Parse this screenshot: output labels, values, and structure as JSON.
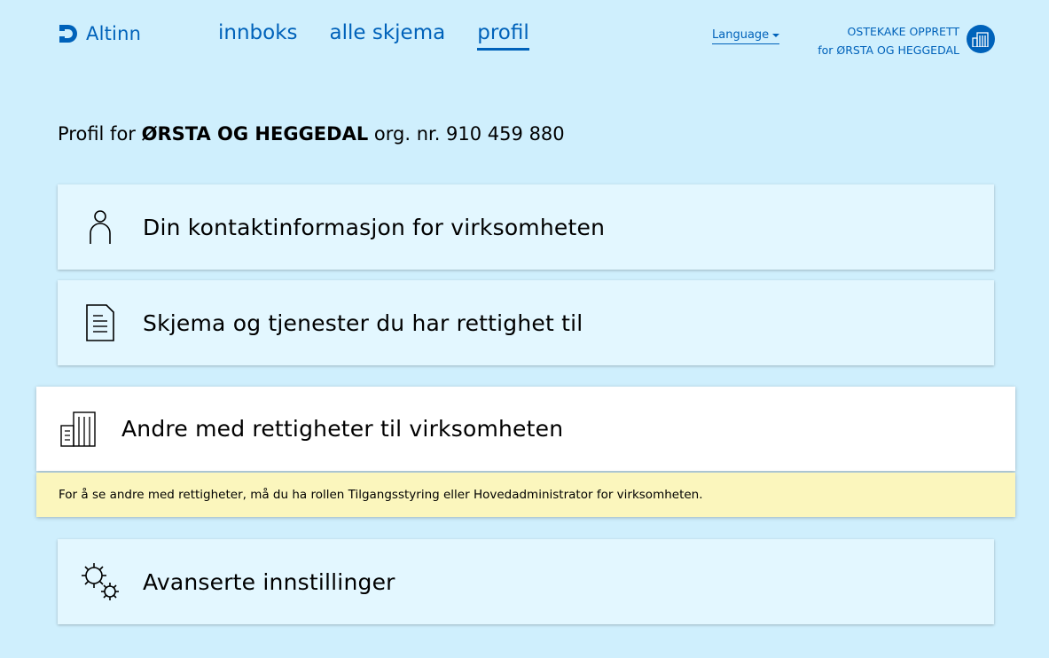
{
  "header": {
    "logo_text": "Altinn",
    "nav": [
      {
        "label": "innboks",
        "active": false
      },
      {
        "label": "alle skjema",
        "active": false
      },
      {
        "label": "profil",
        "active": true
      }
    ],
    "language_label": "Language",
    "actor_line1": "OSTEKAKE OPPRETT",
    "actor_line2": "for ØRSTA OG HEGGEDAL"
  },
  "profile": {
    "prefix": "Profil for ",
    "org_name": "ØRSTA OG HEGGEDAL",
    "org_label": " org. nr. 910 459 880"
  },
  "cards": [
    {
      "title": "Din kontaktinformasjon for virksomheten",
      "icon": "person-icon"
    },
    {
      "title": "Skjema og tjenester du har rettighet til",
      "icon": "document-icon"
    },
    {
      "title": "Andre med rettigheter til virksomheten",
      "icon": "buildings-icon",
      "expanded": true
    },
    {
      "title": "Avanserte innstillinger",
      "icon": "gears-icon"
    }
  ],
  "notice": "For å se andre med rettigheter, må du ha rollen Tilgangsstyring eller Hovedadministrator for virksomheten.",
  "colors": {
    "background": "#cfeffd",
    "brand": "#0062ba",
    "card": "#e3f7ff",
    "notice": "#fbf6bd"
  }
}
